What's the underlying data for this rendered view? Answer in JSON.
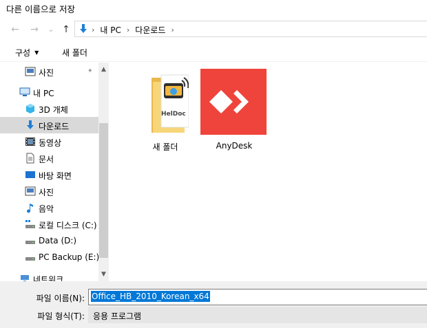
{
  "window": {
    "title": "다른 이름으로 저장"
  },
  "nav": {
    "back": "←",
    "forward": "→",
    "recent": "⌄",
    "up": "↑"
  },
  "address": {
    "crumbs": [
      "내 PC",
      "다운로드"
    ],
    "sep": "›"
  },
  "toolbar": {
    "organize": "구성",
    "organize_caret": "▼",
    "new_folder": "새 폴더"
  },
  "navpane": {
    "items": [
      {
        "label": "사진",
        "icon": "pictures-icon",
        "pinned": true
      },
      {
        "label": "내 PC",
        "icon": "this-pc-icon"
      },
      {
        "label": "3D 개체",
        "icon": "3d-objects-icon"
      },
      {
        "label": "다운로드",
        "icon": "downloads-icon",
        "selected": true
      },
      {
        "label": "동영상",
        "icon": "videos-icon"
      },
      {
        "label": "문서",
        "icon": "documents-icon"
      },
      {
        "label": "바탕 화면",
        "icon": "desktop-icon"
      },
      {
        "label": "사진",
        "icon": "pictures-icon"
      },
      {
        "label": "음악",
        "icon": "music-icon"
      },
      {
        "label": "로컬 디스크 (C:)",
        "icon": "local-disk-icon"
      },
      {
        "label": "Data (D:)",
        "icon": "drive-icon"
      },
      {
        "label": "PC Backup (E:)",
        "icon": "drive-icon"
      },
      {
        "label": "네트워크",
        "icon": "network-icon"
      }
    ],
    "pin_glyph": "📌"
  },
  "scroll": {
    "up": "▲",
    "down": "▼"
  },
  "files": [
    {
      "label": "새 폴더",
      "icon": "folder-icon",
      "badge": "HelDoc"
    },
    {
      "label": "AnyDesk",
      "icon": "anydesk-icon"
    }
  ],
  "footer": {
    "filename_label": "파일 이름(N):",
    "filename_value": "Office_HB_2010_Korean_x64",
    "filetype_label": "파일 형식(T):",
    "filetype_value": "응용 프로그램"
  },
  "colors": {
    "selection": "#0078d7",
    "anydesk_red": "#ef443b",
    "nav_selected": "#d9d9d9"
  }
}
